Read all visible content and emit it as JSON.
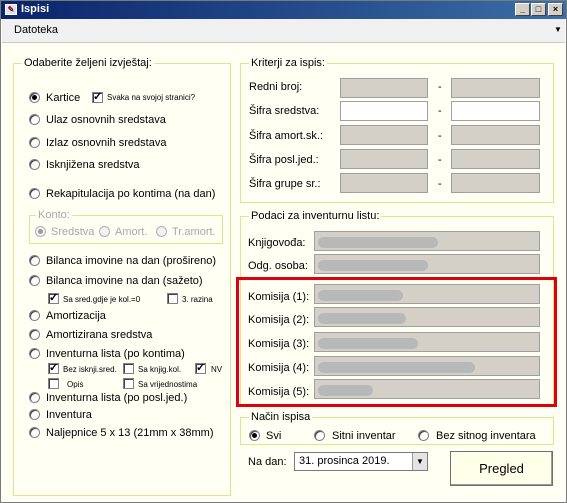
{
  "window": {
    "title": "Ispisi",
    "controls": [
      "_",
      "□",
      "×"
    ]
  },
  "menubar": {
    "file_label": "Datoteka"
  },
  "report_group": {
    "title": "Odaberite željeni izvještaj:",
    "kartice": "Kartice",
    "svaka_na_svojoj": "Svaka na svojoj stranici?",
    "ulaz": "Ulaz osnovnih sredstava",
    "izlaz": "Izlaz osnovnih sredstava",
    "iskljuzena": "Isknjižena sredstva",
    "rekapitulacija": "Rekapitulacija po kontima (na dan)",
    "konto": {
      "title": "Konto:",
      "sredstva": "Sredstva",
      "amort": "Amort.",
      "tr_amort": "Tr.amort."
    },
    "bilanca_prosireno": "Bilanca imovine na dan (prošireno)",
    "bilanca_sazeto": "Bilanca imovine na dan (sažeto)",
    "sa_sred_gdje": "Sa sred.gdje je kol.=0",
    "treca_razina": "3. razina",
    "amortizacija": "Amortizacija",
    "amortizirana": "Amortizirana sredstva",
    "inventurna_kontima": "Inventurna lista (po kontima)",
    "bez_isknji": "Bez isknji.sred.",
    "sa_knjig_kol": "Sa knjig.kol.",
    "nv": "NV",
    "opis": "Opis",
    "sa_vrijednostima": "Sa vrijednostima",
    "inventurna_posl": "Inventurna lista (po posl.jed.)",
    "inventura": "Inventura",
    "naljepnice": "Naljepnice 5 x 13 (21mm x 38mm)"
  },
  "criteria_group": {
    "title": "Kriterji za ispis:",
    "redni_broj": "Redni broj:",
    "sifra_sredstva": "Šifra sredstva:",
    "sifra_amort": "Šifra amort.sk.:",
    "sifra_posl": "Šifra posl.jed.:",
    "sifra_grupe": "Šifra grupe sr.:",
    "dash": "-"
  },
  "inventory_group": {
    "title": "Podaci za inventurnu listu:",
    "knjigovodja": "Knjigovođa:",
    "odg_osoba": "Odg. osoba:",
    "komisija1": "Komisija (1):",
    "komisija2": "Komisija (2):",
    "komisija3": "Komisija (3):",
    "komisija4": "Komisija (4):",
    "komisija5": "Komisija (5):"
  },
  "print_mode_group": {
    "title": "Način ispisa",
    "svi": "Svi",
    "sitni": "Sitni inventar",
    "bez_sitnog": "Bez sitnog inventara"
  },
  "date": {
    "label": "Na dan:",
    "value": "31. prosinca 2019."
  },
  "print_button": "Pregled",
  "colors": {
    "title_bar": "#0a246a",
    "group_border": "#e6e28a",
    "highlight": "#e0000d",
    "window_bg": "#fffff4"
  }
}
